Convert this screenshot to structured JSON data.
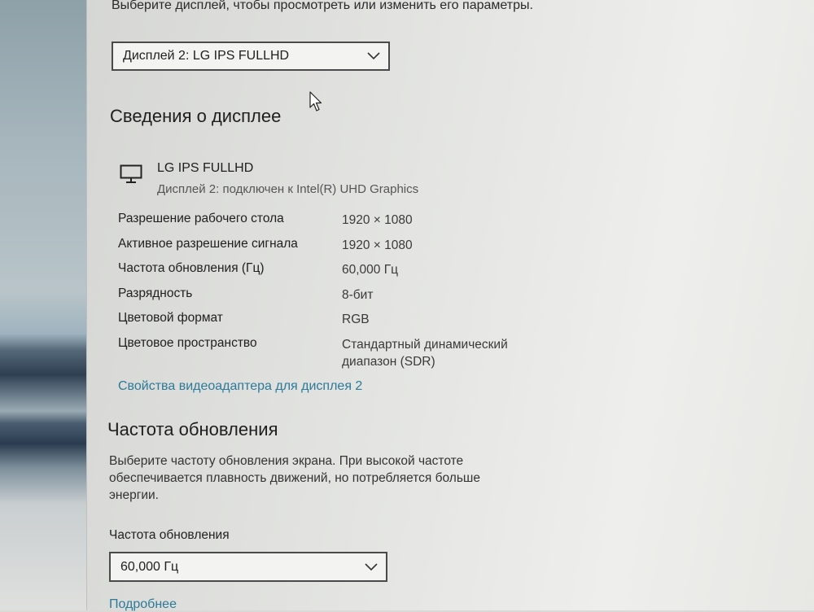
{
  "intro_text": "Выберите дисплей, чтобы просмотреть или изменить его параметры.",
  "display_select": {
    "value": "Дисплей 2: LG IPS FULLHD"
  },
  "display_info": {
    "title": "Сведения о дисплее",
    "monitor_icon": "monitor-icon",
    "monitor_name": "LG IPS FULLHD",
    "monitor_connection": "Дисплей 2: подключен к Intel(R) UHD Graphics",
    "rows": [
      {
        "label": "Разрешение рабочего стола",
        "value": "1920 × 1080"
      },
      {
        "label": "Активное разрешение сигнала",
        "value": "1920 × 1080"
      },
      {
        "label": "Частота обновления (Гц)",
        "value": "60,000 Гц"
      },
      {
        "label": "Разрядность",
        "value": "8-бит"
      },
      {
        "label": "Цветовой формат",
        "value": "RGB"
      },
      {
        "label": "Цветовое пространство",
        "value": "Стандартный динамический диапазон (SDR)"
      }
    ],
    "adapter_link": "Свойства видеоадаптера для дисплея 2"
  },
  "refresh": {
    "title": "Частота обновления",
    "description": "Выберите частоту обновления экрана. При высокой частоте обеспечивается плавность движений, но потребляется больше энергии.",
    "field_label": "Частота обновления",
    "value": "60,000 Гц",
    "more_link": "Подробнее"
  },
  "colors": {
    "link": "#2b7a9a",
    "border": "#4a4a4a"
  }
}
